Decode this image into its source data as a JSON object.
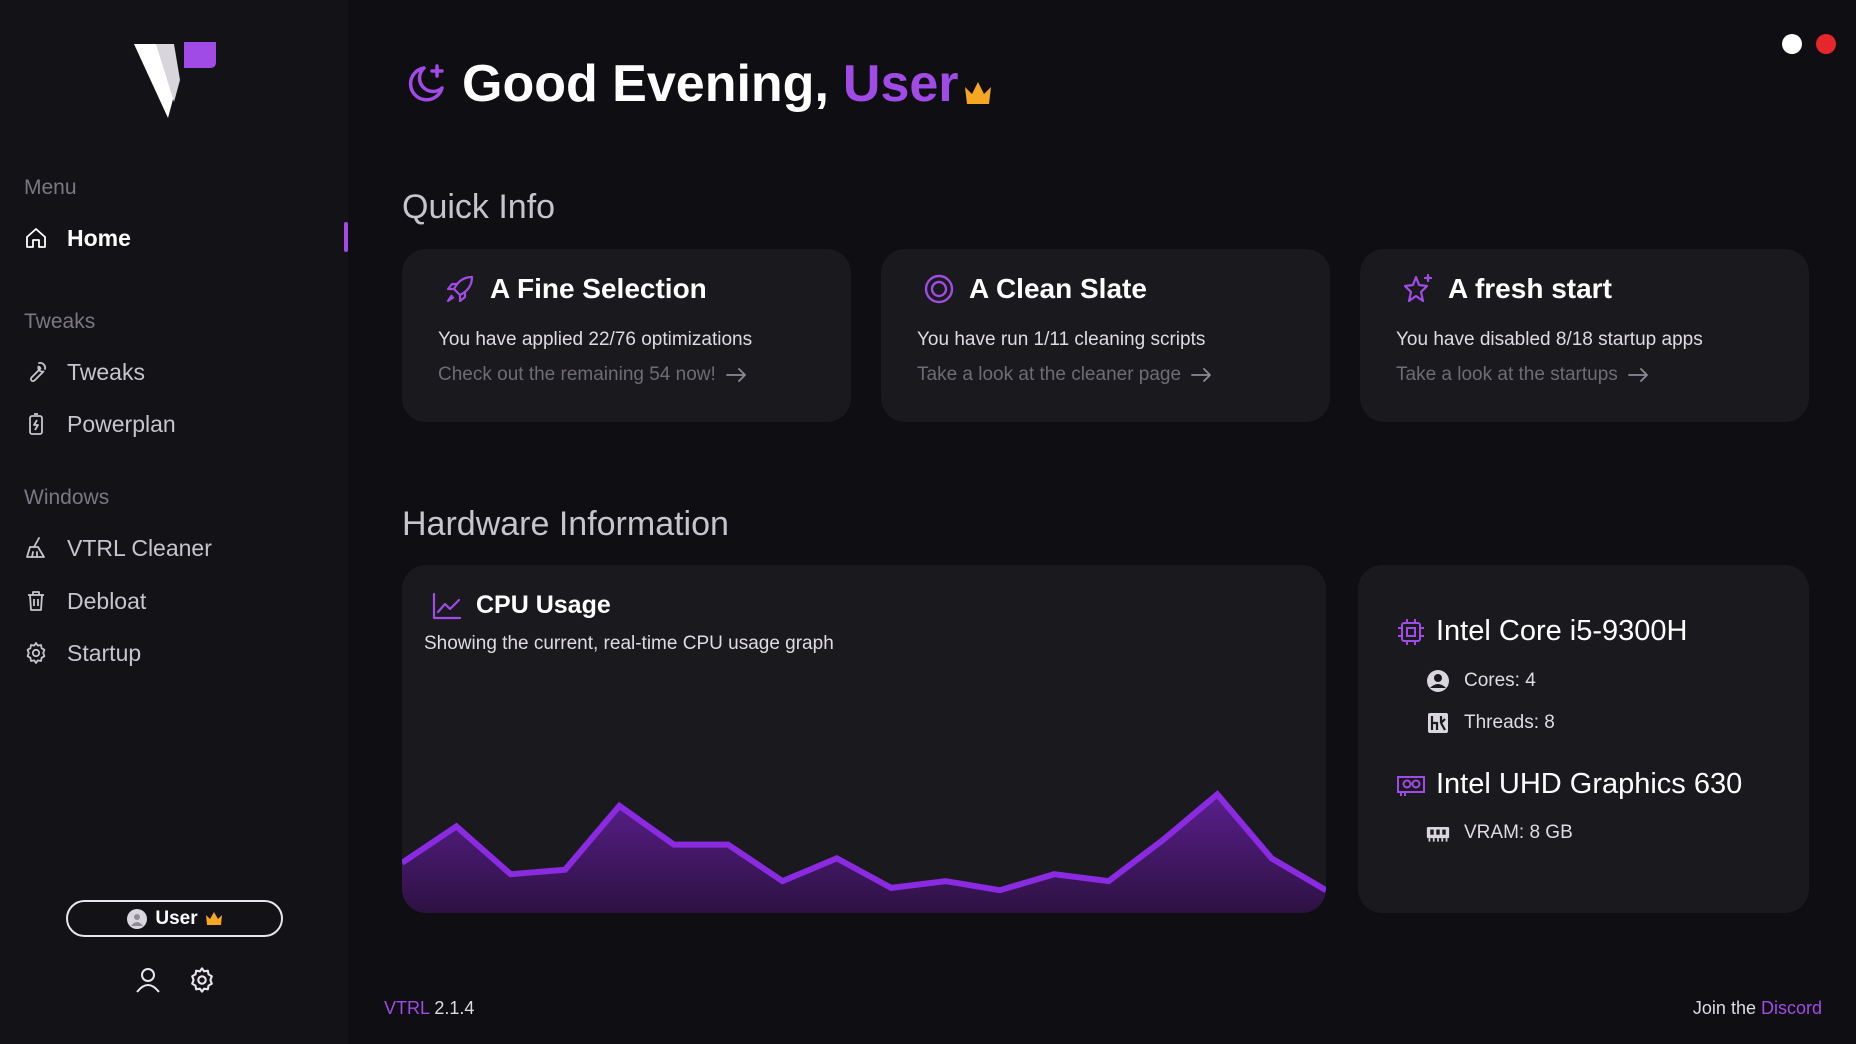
{
  "sidebar": {
    "logo": "vtrl-logo",
    "sections": {
      "menu": "Menu",
      "tweaks": "Tweaks",
      "windows": "Windows"
    },
    "items": [
      {
        "label": "Home",
        "icon": "home-icon",
        "active": true
      },
      {
        "label": "Tweaks",
        "icon": "wrench-icon"
      },
      {
        "label": "Powerplan",
        "icon": "battery-icon"
      },
      {
        "label": "VTRL Cleaner",
        "icon": "broom-icon"
      },
      {
        "label": "Debloat",
        "icon": "trash-icon"
      },
      {
        "label": "Startup",
        "icon": "gear-icon"
      }
    ],
    "user_pill": {
      "label": "User",
      "avatar": "avatar-icon",
      "badge": "crown-icon"
    }
  },
  "header": {
    "greeting": "Good Evening,",
    "user_name": "User",
    "icon": "moon-icon",
    "badge": "crown-icon"
  },
  "window_controls": {
    "colors": [
      "#ffffff",
      "#e5262c"
    ]
  },
  "quick_info": {
    "title": "Quick Info",
    "cards": [
      {
        "title": "A Fine Selection",
        "icon": "rocket-icon",
        "text": "You have applied 22/76 optimizations",
        "link": "Check out the remaining 54 now!"
      },
      {
        "title": "A Clean Slate",
        "icon": "target-icon",
        "text": "You have run 1/11 cleaning scripts",
        "link": "Take a look at the cleaner page"
      },
      {
        "title": "A fresh start",
        "icon": "sparkle-star-icon",
        "text": "You have disabled 8/18 startup apps",
        "link": "Take a look at the startups"
      }
    ]
  },
  "hardware": {
    "title": "Hardware Information",
    "cpu_usage": {
      "title": "CPU Usage",
      "subtitle": "Showing the current, real-time CPU usage graph"
    },
    "cpu": {
      "name": "Intel Core i5-9300H",
      "cores": "Cores: 4",
      "threads": "Threads: 8"
    },
    "gpu": {
      "name": "Intel UHD Graphics 630",
      "vram": "VRAM: 8 GB"
    }
  },
  "chart_data": {
    "type": "area",
    "y": [
      22,
      38,
      17,
      19,
      47,
      30,
      30,
      14,
      24,
      11,
      14,
      10,
      17,
      14,
      32,
      52,
      24,
      10
    ],
    "ylim": [
      0,
      100
    ]
  },
  "footer": {
    "brand": "VTRL",
    "version": "2.1.4",
    "join_text": "Join the",
    "join_link": "Discord"
  },
  "colors": {
    "accent": "#a04be6",
    "background": "#0f0e12",
    "card": "#1a191d",
    "sidebar": "#131216"
  }
}
